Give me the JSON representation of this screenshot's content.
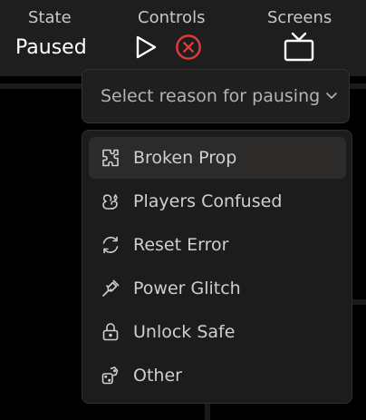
{
  "topbar": {
    "state_header": "State",
    "state_value": "Paused",
    "controls_header": "Controls",
    "screens_header": "Screens",
    "play_icon": "play-icon",
    "stop_icon": "close-circle-icon",
    "screen_icon": "tv-icon",
    "stop_color": "#e03a3a"
  },
  "select": {
    "placeholder": "Select reason for pausing",
    "chevron_icon": "chevron-down-icon"
  },
  "menu": {
    "items": [
      {
        "label": "Broken Prop",
        "icon": "puzzle-icon",
        "highlighted": true
      },
      {
        "label": "Players Confused",
        "icon": "squirrel-icon",
        "highlighted": false
      },
      {
        "label": "Reset Error",
        "icon": "refresh-icon",
        "highlighted": false
      },
      {
        "label": "Power Glitch",
        "icon": "plug-icon",
        "highlighted": false
      },
      {
        "label": "Unlock Safe",
        "icon": "lock-icon",
        "highlighted": false
      },
      {
        "label": "Other",
        "icon": "dice-icon",
        "highlighted": false
      }
    ]
  }
}
